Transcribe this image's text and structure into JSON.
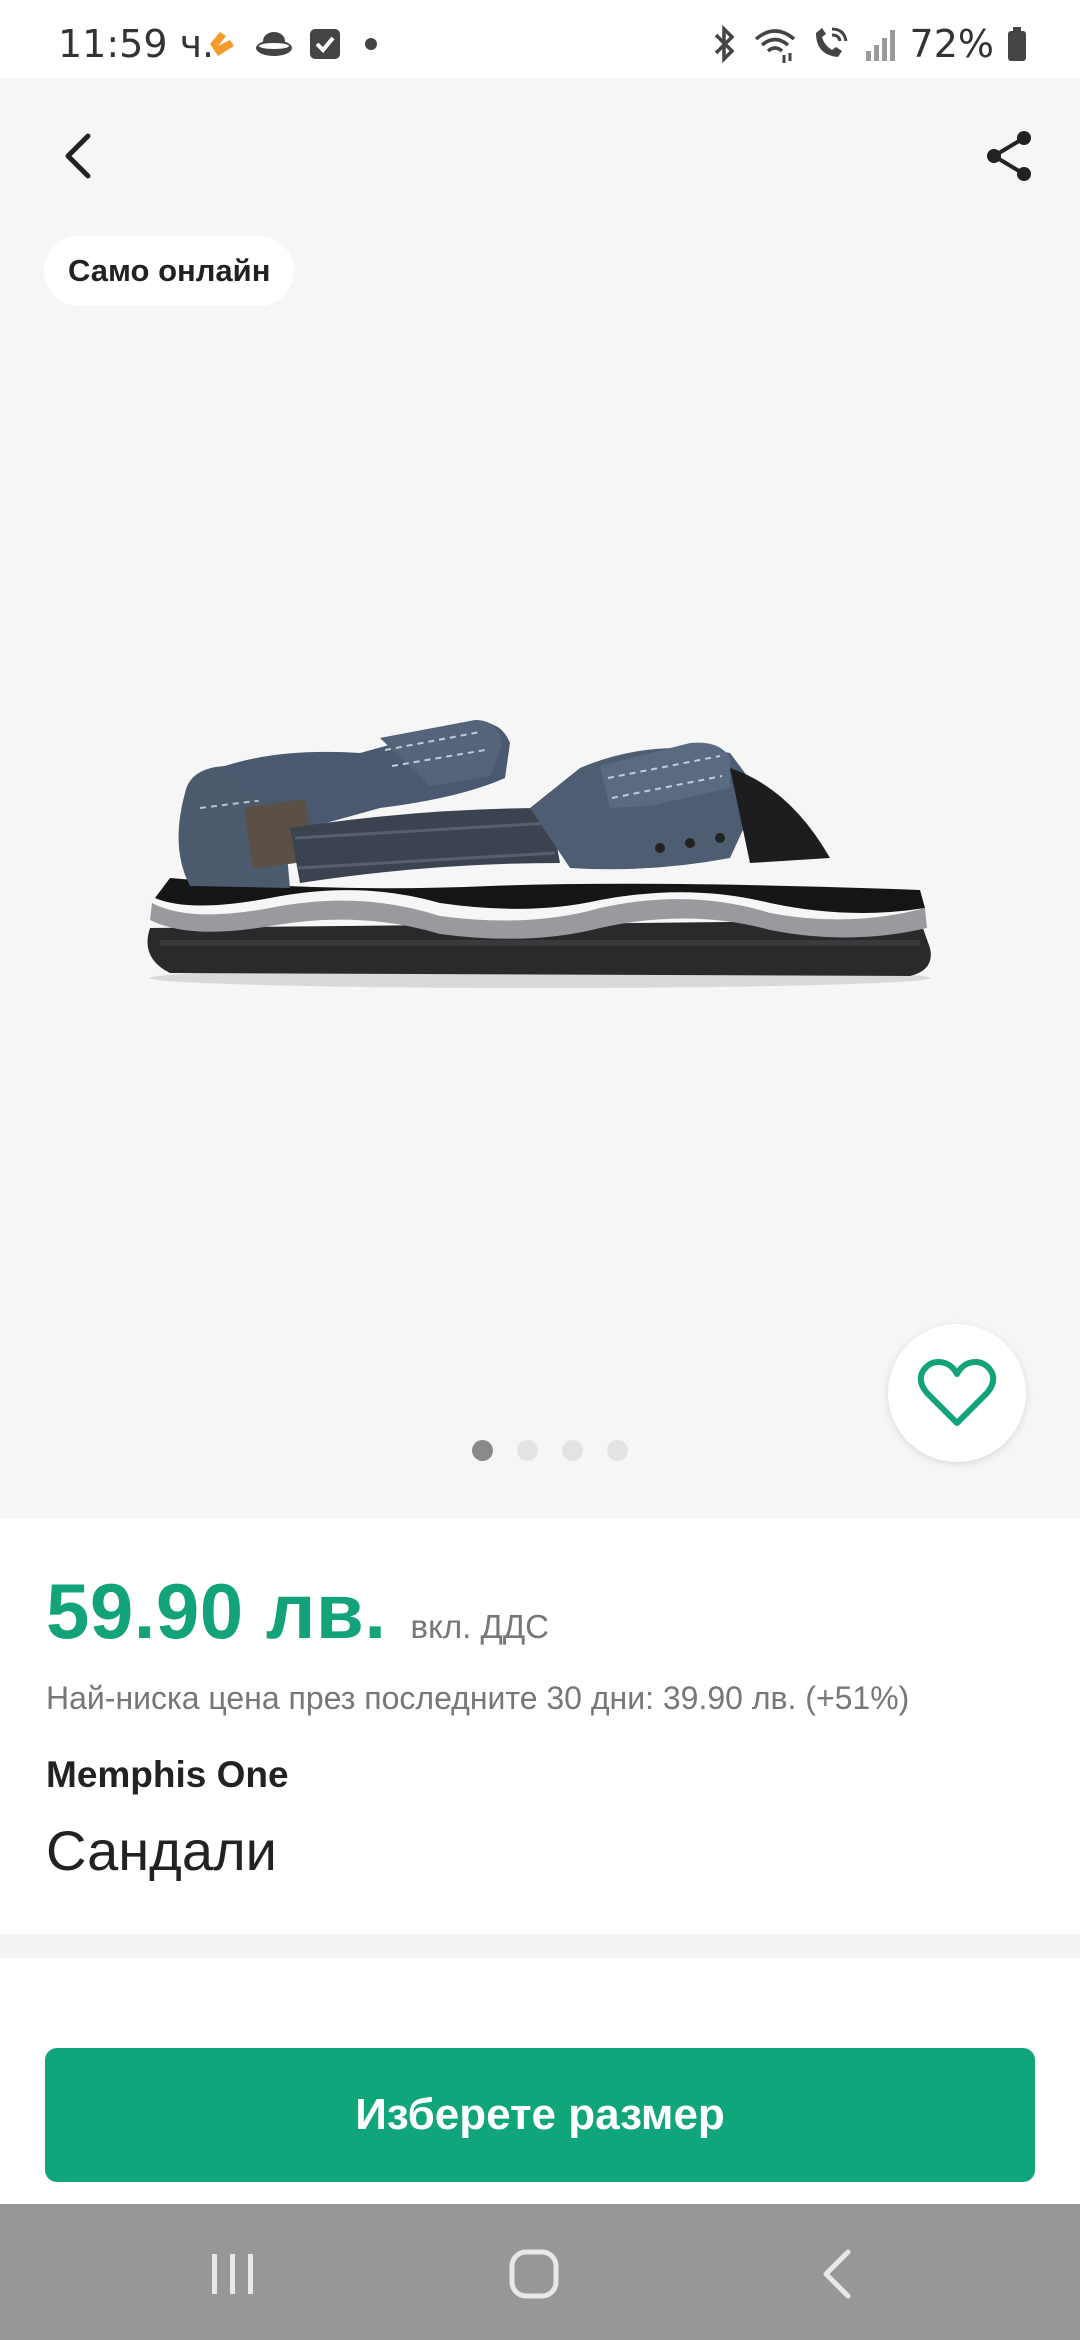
{
  "status_bar": {
    "time": "11:59 ч.",
    "battery": "72%",
    "icons": [
      "avast-icon",
      "hat-icon",
      "checkbox-icon",
      "dot-icon",
      "bluetooth-icon",
      "wifi-icon",
      "wifi-calling-icon",
      "signal-icon",
      "battery-icon"
    ]
  },
  "gallery": {
    "badge": "Само онлайн",
    "image_alt": "Sandal product photo",
    "pagination": {
      "total": 4,
      "current": 1
    }
  },
  "product": {
    "price": "59.90 лв.",
    "vat_note": "вкл. ДДС",
    "lowest_price_note": "Най-ниска цена през последните 30 дни: 39.90 лв. (+51%)",
    "brand": "Memphis One",
    "title": "Сандали"
  },
  "cta": {
    "select_size": "Изберете размер"
  },
  "colors": {
    "accent": "#12a37a",
    "button": "#11a57c",
    "gallery_bg": "#f6f6f6",
    "nav_bg": "#979797"
  }
}
